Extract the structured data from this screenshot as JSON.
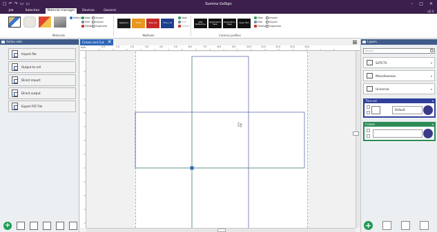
{
  "window": {
    "title": "Summa GoSign",
    "version": "v2.3"
  },
  "menu": {
    "tabs": [
      "Job",
      "Selection",
      "Material manager",
      "Devices",
      "General"
    ],
    "active": "Material manager"
  },
  "ribbon": {
    "materials_label": "Materials",
    "methods_label": "Methods",
    "camera_profiles_label": "Camera profiles",
    "material_cmds": {
      "default": "Default",
      "new": "New",
      "edit": "Edit",
      "delete": "Delete",
      "import": "Import",
      "export": "Export",
      "duplicate": "Duplicate"
    },
    "method_tiles": [
      {
        "label": "Regmark",
        "color": "#1b1b1b"
      },
      {
        "label": "Draw",
        "color": "#e8961e"
      },
      {
        "label": "Kiss-cut",
        "color": "#c62828"
      },
      {
        "label": "Thru-cut",
        "color": "#1e3f8f"
      }
    ],
    "method_cmds": {
      "new": "New",
      "edit": "Edit",
      "delete": "Delete"
    },
    "camera_tiles": [
      {
        "label": "ARX Reflective",
        "color": "#111111"
      },
      {
        "label": "Application tape",
        "color": "#111111"
      },
      {
        "label": "Application tape",
        "color": "#111111"
      },
      {
        "label": "Clear film",
        "color": "#111111"
      }
    ],
    "camera_cmds": {
      "new": "New",
      "edit": "Edit",
      "delete": "Delete",
      "import": "Import",
      "export": "Export",
      "duplicate": "Duplicate"
    }
  },
  "left_panel": {
    "title": "Action sets",
    "actions": [
      "Import file",
      "Output to roll",
      "Direct import",
      "Direct output",
      "Export PLT File"
    ]
  },
  "document": {
    "tab": "Cream and Cut",
    "unit": "inch",
    "ruler_labels": [
      "0.0",
      "1.0",
      "2.0",
      "3.0",
      "4.0",
      "5.0",
      "6.0",
      "7.0",
      "8.0",
      "9.0",
      "10.0",
      "11.0",
      "12.0",
      "13.0",
      "14.0"
    ]
  },
  "right_panel": {
    "title": "Layers",
    "search_placeholder": "Search",
    "groups": [
      "SUTC75",
      "Miscellaneous",
      "Universal"
    ],
    "layers": [
      {
        "name": "Thru-cut",
        "tool_setting": "Default",
        "accent": "#2f3f9a"
      },
      {
        "name": "Crease",
        "tool_setting": "",
        "accent": "#2e8b57"
      }
    ]
  },
  "colors": {
    "title_bar": "#3c1f4d",
    "panel_header": "#3f5b8a",
    "doc_tab": "#2f67b7",
    "cut_line": "#4b57a8",
    "crease_line": "#3da35d"
  }
}
